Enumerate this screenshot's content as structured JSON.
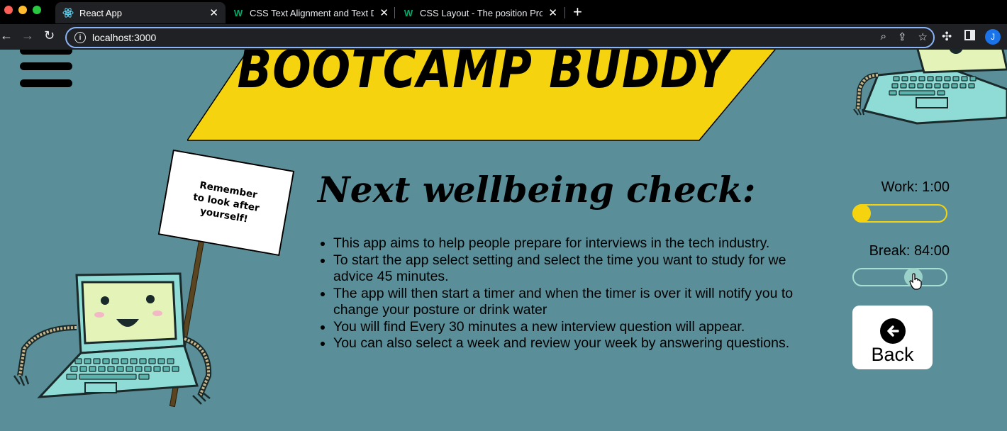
{
  "browser": {
    "tabs": [
      {
        "title": "React App",
        "favicon": "react-icon",
        "active": true
      },
      {
        "title": "CSS Text Alignment and Text D",
        "favicon": "w3schools-icon",
        "active": false
      },
      {
        "title": "CSS Layout - The position Prop",
        "favicon": "w3schools-icon",
        "active": false
      }
    ],
    "new_tab": "+",
    "url": "localhost:3000",
    "profile_initial": "J"
  },
  "page": {
    "banner_title": "BOOTCAMP BUDDY",
    "heading": "Next wellbeing check:",
    "info_items": [
      "This app aims to help people prepare for interviews in the tech industry.",
      "To start the app select setting and select the time you want to study for we advice 45 minutes.",
      "The app will then start a timer and when the timer is over it will notify you to change your posture or drink water",
      "You will find Every 30 minutes a new interview question will appear.",
      "You can also select a week and review your week by answering questions."
    ],
    "sign_text": "Remember\nto look after\nyourself!",
    "work": {
      "label": "Work: 1:00",
      "level": 0
    },
    "break": {
      "label": "Break: 84:00",
      "level": 0.7
    },
    "back_button": {
      "label": "Back",
      "icon": "arrow-left-icon"
    }
  },
  "colors": {
    "background": "#5a8e98",
    "banner": "#f5d40f",
    "laptop_body": "#8fdcd6",
    "laptop_screen": "#e4f3b8"
  }
}
